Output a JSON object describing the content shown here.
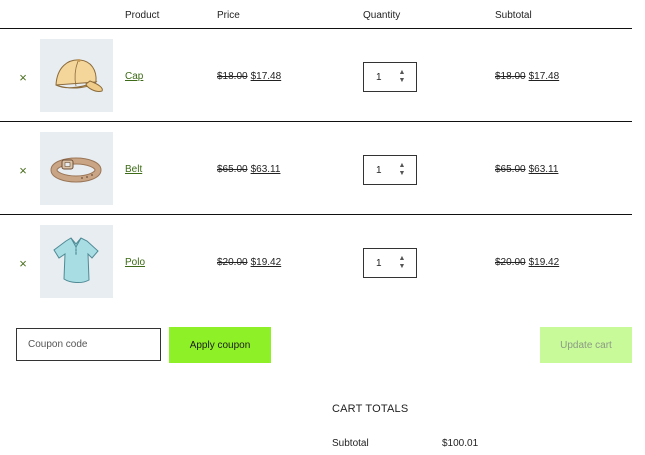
{
  "table": {
    "headers": {
      "product": "Product",
      "price": "Price",
      "quantity": "Quantity",
      "subtotal": "Subtotal"
    },
    "remove_symbol": "×",
    "items": [
      {
        "name": "Cap",
        "icon": "cap-image",
        "old_price": "$18.00",
        "price": "$17.48",
        "quantity": "1",
        "old_subtotal": "$18.00",
        "subtotal": "$17.48"
      },
      {
        "name": "Belt",
        "icon": "belt-image",
        "old_price": "$65.00",
        "price": "$63.11",
        "quantity": "1",
        "old_subtotal": "$65.00",
        "subtotal": "$63.11"
      },
      {
        "name": "Polo",
        "icon": "polo-image",
        "old_price": "$20.00",
        "price": "$19.42",
        "quantity": "1",
        "old_subtotal": "$20.00",
        "subtotal": "$19.42"
      }
    ]
  },
  "coupon": {
    "placeholder": "Coupon code",
    "apply_label": "Apply coupon",
    "update_label": "Update cart"
  },
  "totals": {
    "title": "CART TOTALS",
    "subtotal_label": "Subtotal",
    "subtotal_value": "$100.01"
  },
  "colors": {
    "accent": "#8ef026",
    "accent_disabled": "#c9fa9a",
    "link": "#3c6a16"
  }
}
